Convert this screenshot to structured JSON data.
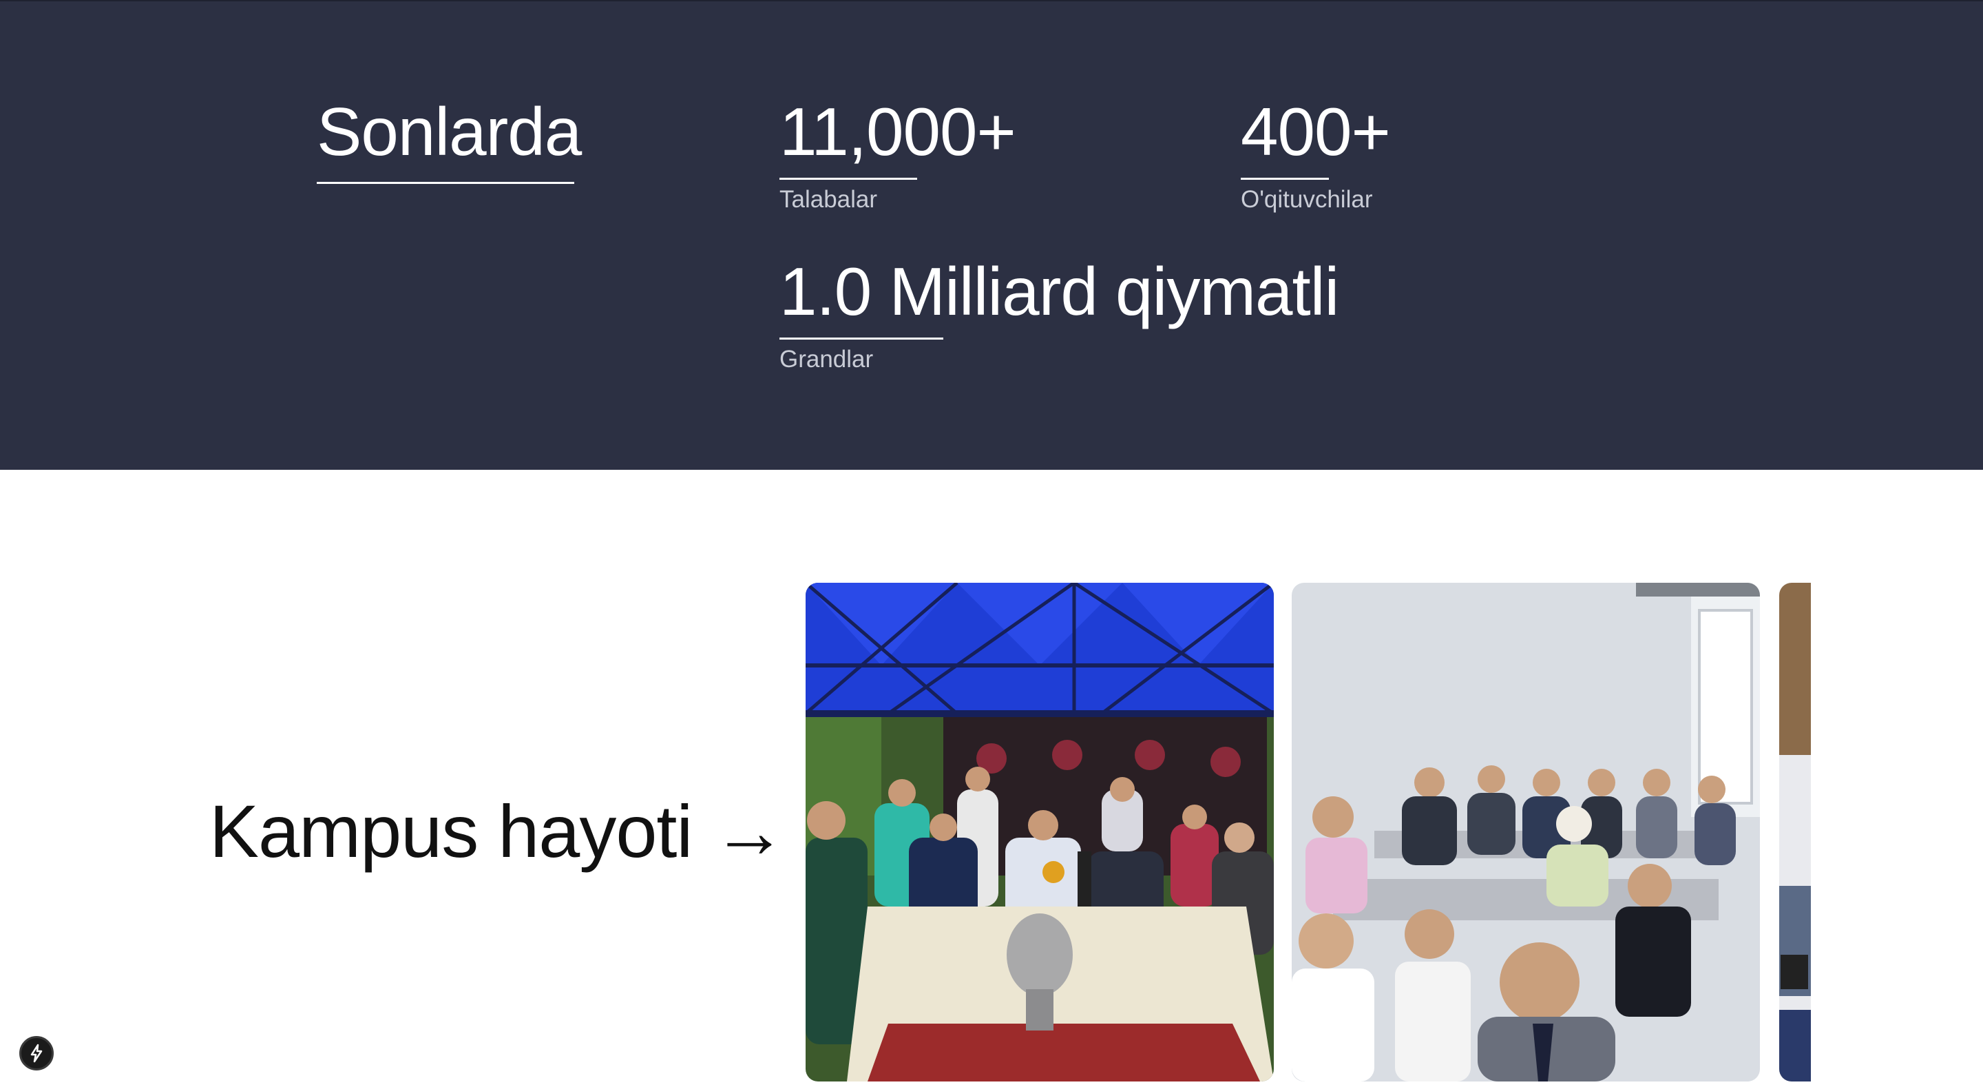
{
  "stats": {
    "title": "Sonlarda",
    "items": [
      {
        "value": "11,000+",
        "label": "Talabalar"
      },
      {
        "value": "400+",
        "label": "O'qituvchilar"
      },
      {
        "value": "1.0 Milliard qiymatli",
        "label": "Grandlar"
      }
    ]
  },
  "campus": {
    "link_text": "Kampus hayoti →"
  },
  "colors": {
    "stats_background": "#2c3043",
    "page_background": "#ffffff",
    "text_dark": "#111111"
  },
  "icons": {
    "floating_button": "lightning-bolt-icon"
  }
}
